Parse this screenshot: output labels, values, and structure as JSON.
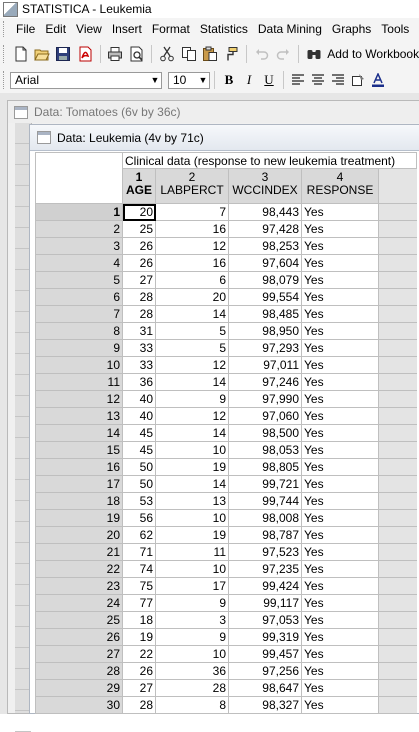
{
  "window": {
    "title": "STATISTICA - Leukemia"
  },
  "menu": [
    "File",
    "Edit",
    "View",
    "Insert",
    "Format",
    "Statistics",
    "Data Mining",
    "Graphs",
    "Tools"
  ],
  "toolbar": {
    "icons": [
      "new-file-icon",
      "open-folder-icon",
      "save-icon",
      "pdf-icon",
      "print-icon",
      "print-preview-icon",
      "cut-icon",
      "copy-icon",
      "paste-icon",
      "format-painter-icon",
      "undo-icon",
      "redo-icon",
      "binoculars-icon"
    ],
    "add_to_workbook": "Add to Workbook"
  },
  "format_bar": {
    "font": "Arial",
    "size": "10",
    "bold": "B",
    "italic": "I",
    "underline": "U"
  },
  "back_window": {
    "title": "Data: Tomatoes (6v by 36c)"
  },
  "front_window": {
    "title": "Data: Leukemia (4v by 71c)"
  },
  "spreadsheet": {
    "banner": "Clinical data (response to new leukemia treatment)",
    "columns": [
      {
        "num": "1",
        "name": "AGE"
      },
      {
        "num": "2",
        "name": "LABPERCT"
      },
      {
        "num": "3",
        "name": "WCCINDEX"
      },
      {
        "num": "4",
        "name": "RESPONSE"
      }
    ],
    "rows": [
      {
        "n": "1",
        "age": "20",
        "lab": "7",
        "wcc": "98,443",
        "resp": "Yes"
      },
      {
        "n": "2",
        "age": "25",
        "lab": "16",
        "wcc": "97,428",
        "resp": "Yes"
      },
      {
        "n": "3",
        "age": "26",
        "lab": "12",
        "wcc": "98,253",
        "resp": "Yes"
      },
      {
        "n": "4",
        "age": "26",
        "lab": "16",
        "wcc": "97,604",
        "resp": "Yes"
      },
      {
        "n": "5",
        "age": "27",
        "lab": "6",
        "wcc": "98,079",
        "resp": "Yes"
      },
      {
        "n": "6",
        "age": "28",
        "lab": "20",
        "wcc": "99,554",
        "resp": "Yes"
      },
      {
        "n": "7",
        "age": "28",
        "lab": "14",
        "wcc": "98,485",
        "resp": "Yes"
      },
      {
        "n": "8",
        "age": "31",
        "lab": "5",
        "wcc": "98,950",
        "resp": "Yes"
      },
      {
        "n": "9",
        "age": "33",
        "lab": "5",
        "wcc": "97,293",
        "resp": "Yes"
      },
      {
        "n": "10",
        "age": "33",
        "lab": "12",
        "wcc": "97,011",
        "resp": "Yes"
      },
      {
        "n": "11",
        "age": "36",
        "lab": "14",
        "wcc": "97,246",
        "resp": "Yes"
      },
      {
        "n": "12",
        "age": "40",
        "lab": "9",
        "wcc": "97,990",
        "resp": "Yes"
      },
      {
        "n": "13",
        "age": "40",
        "lab": "12",
        "wcc": "97,060",
        "resp": "Yes"
      },
      {
        "n": "14",
        "age": "45",
        "lab": "14",
        "wcc": "98,500",
        "resp": "Yes"
      },
      {
        "n": "15",
        "age": "45",
        "lab": "10",
        "wcc": "98,053",
        "resp": "Yes"
      },
      {
        "n": "16",
        "age": "50",
        "lab": "19",
        "wcc": "98,805",
        "resp": "Yes"
      },
      {
        "n": "17",
        "age": "50",
        "lab": "14",
        "wcc": "99,721",
        "resp": "Yes"
      },
      {
        "n": "18",
        "age": "53",
        "lab": "13",
        "wcc": "99,744",
        "resp": "Yes"
      },
      {
        "n": "19",
        "age": "56",
        "lab": "10",
        "wcc": "98,008",
        "resp": "Yes"
      },
      {
        "n": "20",
        "age": "62",
        "lab": "19",
        "wcc": "98,787",
        "resp": "Yes"
      },
      {
        "n": "21",
        "age": "71",
        "lab": "11",
        "wcc": "97,523",
        "resp": "Yes"
      },
      {
        "n": "22",
        "age": "74",
        "lab": "10",
        "wcc": "97,235",
        "resp": "Yes"
      },
      {
        "n": "23",
        "age": "75",
        "lab": "17",
        "wcc": "99,424",
        "resp": "Yes"
      },
      {
        "n": "24",
        "age": "77",
        "lab": "9",
        "wcc": "99,117",
        "resp": "Yes"
      },
      {
        "n": "25",
        "age": "18",
        "lab": "3",
        "wcc": "97,053",
        "resp": "Yes"
      },
      {
        "n": "26",
        "age": "19",
        "lab": "9",
        "wcc": "99,319",
        "resp": "Yes"
      },
      {
        "n": "27",
        "age": "22",
        "lab": "10",
        "wcc": "99,457",
        "resp": "Yes"
      },
      {
        "n": "28",
        "age": "26",
        "lab": "36",
        "wcc": "97,256",
        "resp": "Yes"
      },
      {
        "n": "29",
        "age": "27",
        "lab": "28",
        "wcc": "98,647",
        "resp": "Yes"
      },
      {
        "n": "30",
        "age": "28",
        "lab": "8",
        "wcc": "98,327",
        "resp": "Yes"
      }
    ]
  },
  "colors": {
    "title_gradient_top": "#f6f8fb",
    "title_gradient_bottom": "#e3e8ef",
    "header_gray": "#d9d9d9"
  }
}
